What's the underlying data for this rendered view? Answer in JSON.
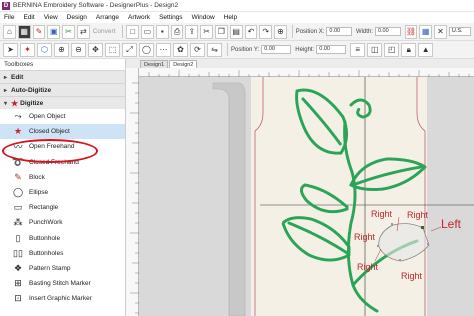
{
  "window": {
    "title": "BERNINA Embroidery Software - DesignerPlus - Design2",
    "logo": "D"
  },
  "menu": [
    "File",
    "Edit",
    "View",
    "Design",
    "Arrange",
    "Artwork",
    "Settings",
    "Window",
    "Help"
  ],
  "toolbar": {
    "convert_label": "Convert",
    "position_x_label": "Position X:",
    "position_y_label": "Position Y:",
    "width_label": "Width:",
    "height_label": "Height:",
    "position_x_value": "0.00",
    "position_y_value": "0.00",
    "width_value": "0.00",
    "height_value": "0.00",
    "unit_select": "U.S."
  },
  "toolboxes": {
    "title": "Toolboxes",
    "sections": {
      "edit": "Edit",
      "auto_digitize": "Auto-Digitize",
      "digitize": "Digitize"
    },
    "items": [
      {
        "label": "Open Object",
        "icon": "open-object-icon"
      },
      {
        "label": "Closed Object",
        "icon": "closed-object-icon"
      },
      {
        "label": "Open Freehand",
        "icon": "open-freehand-icon"
      },
      {
        "label": "Closed Freehand",
        "icon": "closed-freehand-icon"
      },
      {
        "label": "Block",
        "icon": "block-icon"
      },
      {
        "label": "Ellipse",
        "icon": "ellipse-icon"
      },
      {
        "label": "Rectangle",
        "icon": "rectangle-icon"
      },
      {
        "label": "PunchWork",
        "icon": "punchwork-icon"
      },
      {
        "label": "Buttonhole",
        "icon": "buttonhole-icon"
      },
      {
        "label": "Buttonholes",
        "icon": "buttonholes-icon"
      },
      {
        "label": "Pattern Stamp",
        "icon": "pattern-stamp-icon"
      },
      {
        "label": "Basting Stitch Marker",
        "icon": "basting-stitch-marker-icon"
      },
      {
        "label": "Insert Graphic Marker",
        "icon": "insert-graphic-marker-icon"
      }
    ],
    "selected_item": "Closed Object"
  },
  "tabs": [
    "Design1",
    "Design2"
  ],
  "active_tab": "Design2",
  "canvas_labels": {
    "right_1": "Right",
    "right_2": "Right",
    "right_3": "Right",
    "right_4": "Right",
    "right_5": "Right",
    "left": "Left"
  },
  "colors": {
    "stitch_green": "#2aa557",
    "annotation_red": "#c0262b",
    "highlight_red": "#d3131d",
    "selection_blue": "#cfe3f7"
  }
}
